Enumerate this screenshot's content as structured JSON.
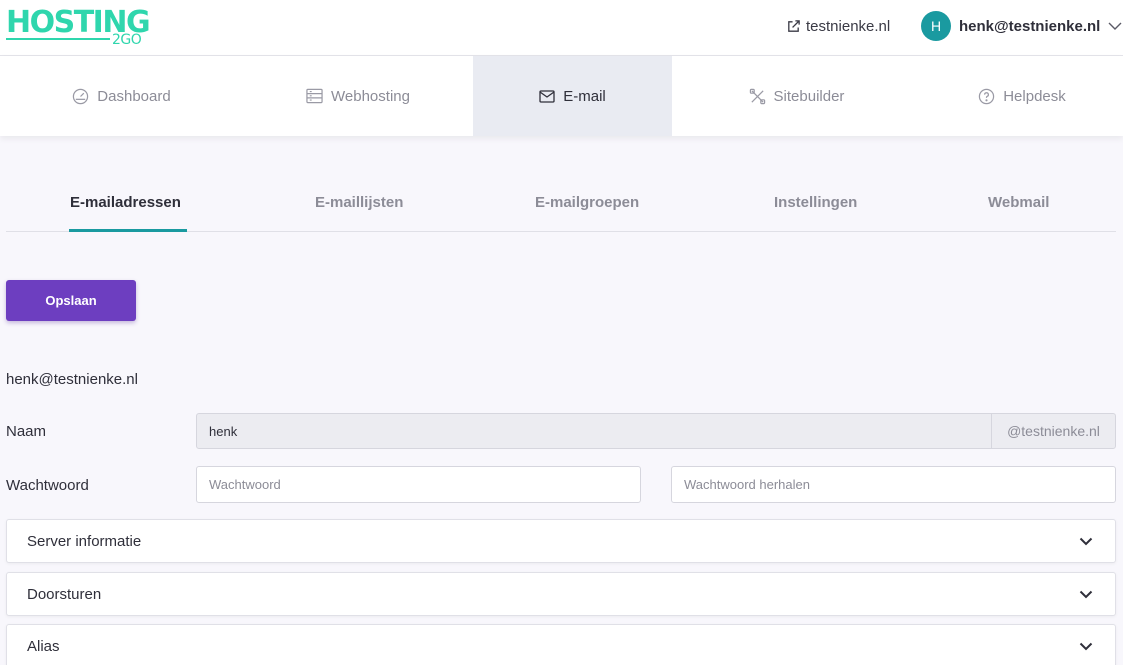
{
  "brand": {
    "logo_main": "HOSTING",
    "logo_sub": "2GO",
    "color": "#2fd6ad"
  },
  "header": {
    "site_link": "testnienke.nl",
    "user": {
      "initial": "H",
      "email": "henk@testnienke.nl",
      "avatar_color": "#1a9aa0"
    }
  },
  "nav": [
    {
      "label": "Dashboard",
      "icon": "dashboard-icon"
    },
    {
      "label": "Webhosting",
      "icon": "server-icon"
    },
    {
      "label": "E-mail",
      "icon": "envelope-icon",
      "active": true
    },
    {
      "label": "Sitebuilder",
      "icon": "tools-icon"
    },
    {
      "label": "Helpdesk",
      "icon": "help-icon"
    }
  ],
  "subtabs": [
    "E-mailadressen",
    "E-maillijsten",
    "E-mailgroepen",
    "Instellingen",
    "Webmail"
  ],
  "actions": {
    "save_label": "Opslaan",
    "save_color": "#6d3ec0"
  },
  "account": {
    "title": "henk@testnienke.nl",
    "name_label": "Naam",
    "name_value": "henk",
    "domain_suffix": "@testnienke.nl",
    "password_label": "Wachtwoord",
    "password_placeholder": "Wachtwoord",
    "password_repeat_placeholder": "Wachtwoord herhalen"
  },
  "sections": [
    "Server informatie",
    "Doorsturen",
    "Alias"
  ]
}
